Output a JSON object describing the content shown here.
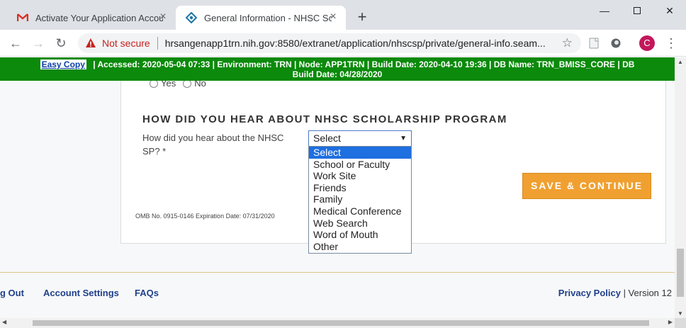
{
  "browser": {
    "tabs": [
      {
        "title": "Activate Your Application Accou",
        "icon": "gmail-icon"
      },
      {
        "title": "General Information - NHSC Scho",
        "icon": "nhsc-icon"
      }
    ],
    "new_tab": "+",
    "security_label": "Not secure",
    "url": "hrsangenapp1trn.nih.gov:8580/extranet/application/nhscsp/private/general-info.seam...",
    "profile_initial": "C"
  },
  "env_banner": {
    "easy_copy": "Easy Copy",
    "line1": "|   Accessed: 2020-05-04 07:33   |   Environment: TRN   |   Node: APP1TRN   |   Build Date: 2020-04-10 19:36   |   DB Name: TRN_BMISS_CORE   |   DB",
    "line2": "Build Date: 04/28/2020"
  },
  "form": {
    "radio_yes": "Yes",
    "radio_no": "No",
    "section_title": "HOW DID YOU HEAR ABOUT NHSC SCHOLARSHIP PROGRAM",
    "question": "How did you hear about the NHSC SP? *",
    "select_value": "Select",
    "options": [
      "Select",
      "School or Faculty",
      "Work Site",
      "Friends",
      "Family",
      "Medical Conference",
      "Web Search",
      "Word of Mouth",
      "Other"
    ],
    "highlighted_option": "Select",
    "save_button": "SAVE & CONTINUE",
    "omb": "OMB No. 0915-0146 Expiration Date: 07/31/2020"
  },
  "footer": {
    "logout": "g Out",
    "account_settings": "Account Settings",
    "faqs": "FAQs",
    "privacy": "Privacy Policy",
    "version": " | Version 12"
  },
  "colors": {
    "env_banner": "#0b8a0b",
    "save_button": "#f0a030",
    "link": "#1f3f8a",
    "dropdown_highlight": "#1e6fe0",
    "not_secure": "#c5221f"
  }
}
